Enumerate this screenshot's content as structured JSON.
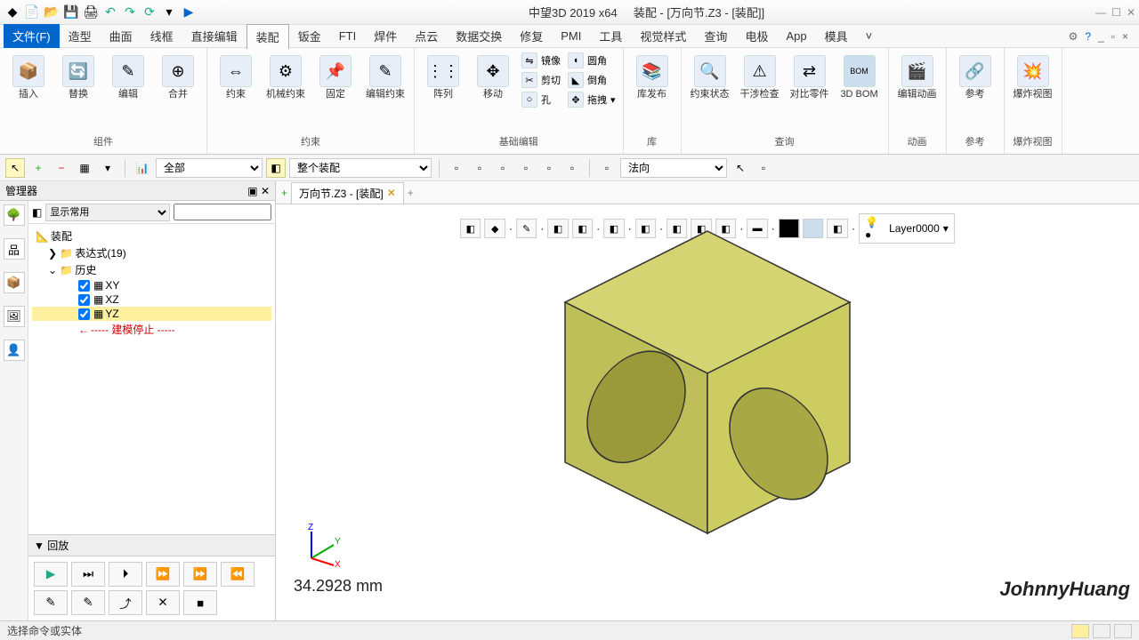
{
  "app": {
    "title_left": "中望3D 2019  x64",
    "title_right": "装配 - [万向节.Z3 - [装配]]"
  },
  "menu": {
    "tabs": [
      "文件(F)",
      "造型",
      "曲面",
      "线框",
      "直接编辑",
      "装配",
      "钣金",
      "FTI",
      "焊件",
      "点云",
      "数据交换",
      "修复",
      "PMI",
      "工具",
      "视觉样式",
      "查询",
      "电极",
      "App",
      "模具"
    ],
    "active": 5
  },
  "ribbon": {
    "groups": [
      {
        "label": "组件",
        "tools": [
          "插入",
          "替换",
          "编辑",
          "合并"
        ]
      },
      {
        "label": "约束",
        "tools": [
          "约束",
          "机械约束",
          "固定",
          "编辑约束"
        ]
      },
      {
        "label": "基础编辑",
        "tools": [
          "阵列",
          "移动"
        ],
        "small": [
          [
            "镜像",
            "圆角"
          ],
          [
            "剪切",
            "倒角"
          ],
          [
            "孔",
            "拖拽"
          ]
        ]
      },
      {
        "label": "库",
        "tools": [
          "库发布"
        ]
      },
      {
        "label": "查询",
        "tools": [
          "约束状态",
          "干涉检查",
          "对比零件",
          "3D BOM"
        ]
      },
      {
        "label": "动画",
        "tools": [
          "编辑动画"
        ]
      },
      {
        "label": "参考",
        "tools": [
          "参考"
        ]
      },
      {
        "label": "爆炸视图",
        "tools": [
          "爆炸视图"
        ]
      }
    ]
  },
  "toolbar2": {
    "filter1": "全部",
    "filter2": "整个装配",
    "filter3": "法向"
  },
  "sidebar": {
    "title": "管理器",
    "display_mode": "显示常用",
    "tree": {
      "root": "装配",
      "exp": "表达式(19)",
      "history": "历史",
      "planes": [
        "XY",
        "XZ",
        "YZ"
      ],
      "stop": "----- 建模停止 -----"
    },
    "replay": {
      "title": "▼ 回放"
    }
  },
  "doc": {
    "tab": "万向节.Z3 - [装配]"
  },
  "view": {
    "layer": "Layer0000",
    "measure": "34.2928 mm",
    "watermark": "JohnnyHuang"
  },
  "status": {
    "text": "选择命令或实体"
  }
}
